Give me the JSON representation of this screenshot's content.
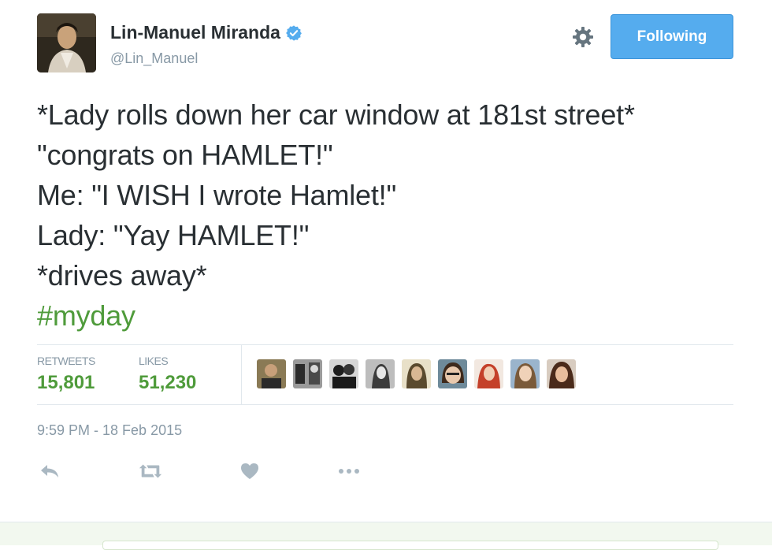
{
  "author": {
    "name": "Lin-Manuel Miranda",
    "handle": "@Lin_Manuel",
    "verified_icon": "verified-badge-icon"
  },
  "header": {
    "settings_icon": "gear-icon",
    "follow_label": "Following",
    "follow_color": "#55acee"
  },
  "tweet": {
    "lines": [
      "*Lady rolls down her car window at 181st street*",
      "\"congrats on HAMLET!\"",
      "Me: \"I WISH I wrote Hamlet!\"",
      "Lady: \"Yay HAMLET!\"",
      "*drives away*"
    ],
    "hashtag": "#myday",
    "hashtag_color": "#4f9b3b"
  },
  "stats": {
    "retweets_label": "RETWEETS",
    "retweets_value": "15,801",
    "likes_label": "LIKES",
    "likes_value": "51,230",
    "liker_avatars": [
      "liker-1",
      "liker-2",
      "liker-3",
      "liker-4",
      "liker-5",
      "liker-6",
      "liker-7",
      "liker-8",
      "liker-9"
    ]
  },
  "timestamp": "9:59 PM - 18 Feb 2015",
  "actions": {
    "reply_icon": "reply-icon",
    "retweet_icon": "retweet-icon",
    "like_icon": "heart-icon",
    "more_icon": "more-icon"
  }
}
